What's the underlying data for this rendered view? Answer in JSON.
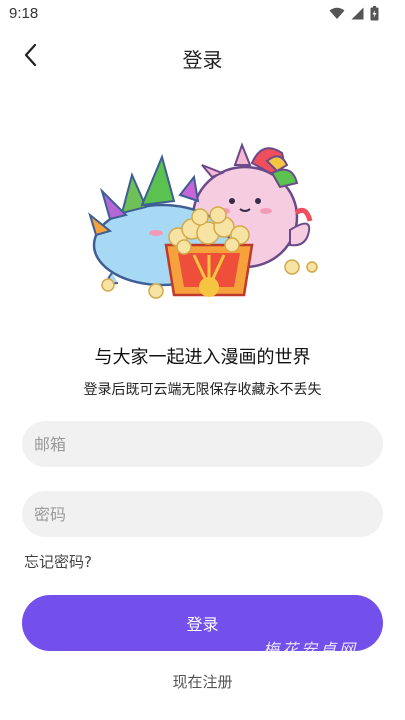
{
  "status_bar": {
    "time": "9:18",
    "icons": [
      "wifi-icon",
      "signal-icon",
      "battery-icon"
    ]
  },
  "header": {
    "title": "登录",
    "back_icon": "chevron-left-icon"
  },
  "illustration": {
    "icon": "mascot-popcorn-illustration"
  },
  "intro": {
    "headline": "与大家一起进入漫画的世界",
    "subline": "登录后既可云端无限保存收藏永不丢失"
  },
  "form": {
    "email_placeholder": "邮箱",
    "email_value": "",
    "password_placeholder": "密码",
    "password_value": "",
    "forgot_label": "忘记密码?"
  },
  "actions": {
    "login_label": "登录",
    "register_label": "现在注册"
  },
  "watermark": {
    "text": "梅花安卓网"
  },
  "colors": {
    "accent": "#7350ec",
    "input_bg": "#f1f1f1"
  }
}
